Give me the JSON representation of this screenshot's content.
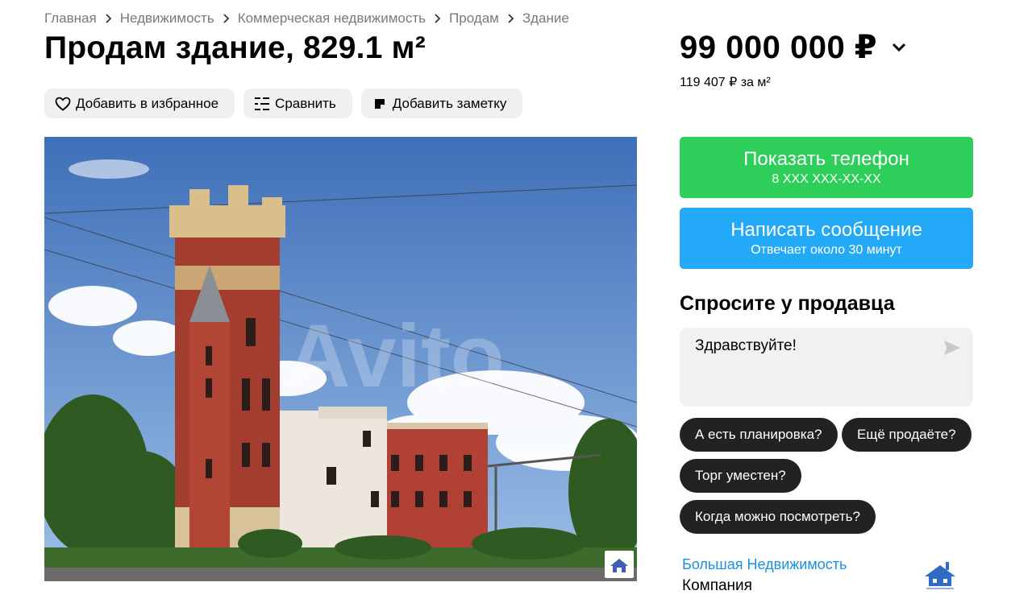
{
  "breadcrumbs": [
    "Главная",
    "Недвижимость",
    "Коммерческая недвижимость",
    "Продам",
    "Здание"
  ],
  "title": "Продам здание, 829.1 м²",
  "actions": {
    "favorite": "Добавить в избранное",
    "compare": "Сравнить",
    "note": "Добавить заметку"
  },
  "photo": {
    "watermark": "Avito",
    "icon": "company-logo-icon"
  },
  "price": {
    "value": "99 000 000 ₽",
    "per_m2": "119 407 ₽ за м²"
  },
  "contact": {
    "phone_label": "Показать телефон",
    "phone_mask": "8 XXX XXX-XX-XX",
    "message_label": "Написать сообщение",
    "message_sub": "Отвечает около 30 минут"
  },
  "ask": {
    "title": "Спросите у продавца",
    "input_value": "Здравствуйте!",
    "chips": [
      "А есть планировка?",
      "Ещё продаёте?",
      "Торг уместен?",
      "Когда можно посмотреть?"
    ]
  },
  "seller": {
    "name": "Большая Недвижимость",
    "type": "Компания"
  },
  "colors": {
    "phone_button": "#2dce59",
    "message_button": "#24a9f8",
    "chip_bg": "#222222",
    "link": "#1a8fe5"
  }
}
